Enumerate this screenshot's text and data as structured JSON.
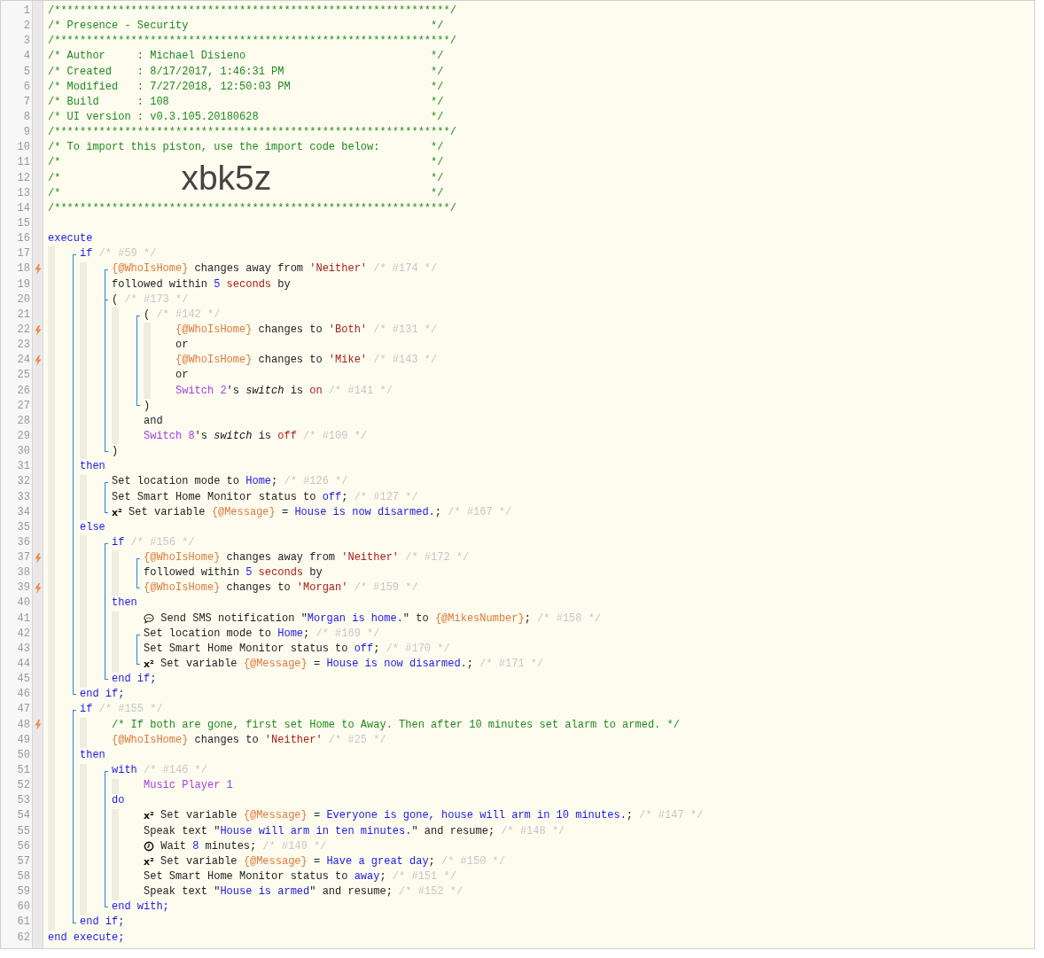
{
  "code": [
    {
      "n": "1",
      "tokens": [
        {
          "kind": "comment",
          "text": "/**************************************************************/"
        }
      ]
    },
    {
      "n": "2",
      "tokens": [
        {
          "kind": "comment",
          "text": "/* Presence - Security"
        },
        {
          "kind": "comment_end",
          "text": "*/"
        }
      ]
    },
    {
      "n": "3",
      "tokens": [
        {
          "kind": "comment",
          "text": "/**************************************************************/"
        }
      ]
    },
    {
      "n": "4",
      "tokens": [
        {
          "kind": "comment",
          "text": "/* Author     : Michael Disieno"
        },
        {
          "kind": "comment_end",
          "text": "*/"
        }
      ]
    },
    {
      "n": "5",
      "tokens": [
        {
          "kind": "comment",
          "text": "/* Created    : 8/17/2017, 1:46:31 PM"
        },
        {
          "kind": "comment_end",
          "text": "*/"
        }
      ]
    },
    {
      "n": "6",
      "tokens": [
        {
          "kind": "comment",
          "text": "/* Modified   : 7/27/2018, 12:50:03 PM"
        },
        {
          "kind": "comment_end",
          "text": "*/"
        }
      ]
    },
    {
      "n": "7",
      "tokens": [
        {
          "kind": "comment",
          "text": "/* Build      : 108"
        },
        {
          "kind": "comment_end",
          "text": "*/"
        }
      ]
    },
    {
      "n": "8",
      "tokens": [
        {
          "kind": "comment",
          "text": "/* UI version : v0.3.105.20180628"
        },
        {
          "kind": "comment_end",
          "text": "*/"
        }
      ]
    },
    {
      "n": "9",
      "tokens": [
        {
          "kind": "comment",
          "text": "/**************************************************************/"
        }
      ]
    },
    {
      "n": "10",
      "tokens": [
        {
          "kind": "comment",
          "text": "/* To import this piston, use the import code below:"
        },
        {
          "kind": "comment_end",
          "text": "*/"
        }
      ]
    },
    {
      "n": "11",
      "tokens": [
        {
          "kind": "comment",
          "text": "/*"
        },
        {
          "kind": "comment_end",
          "text": "*/"
        }
      ]
    },
    {
      "n": "12",
      "tokens": [
        {
          "kind": "comment",
          "text": "/*"
        },
        {
          "kind": "import_code",
          "text": "xbk5z"
        },
        {
          "kind": "comment_end",
          "text": "*/"
        }
      ]
    },
    {
      "n": "13",
      "tokens": [
        {
          "kind": "comment",
          "text": "/*"
        },
        {
          "kind": "comment_end",
          "text": "*/"
        }
      ]
    },
    {
      "n": "14",
      "tokens": [
        {
          "kind": "comment",
          "text": "/**************************************************************/"
        }
      ]
    },
    {
      "n": "15"
    },
    {
      "n": "16",
      "tokens": [
        {
          "kind": "keyword",
          "text": "execute"
        }
      ],
      "children": [
        {
          "kind": "group",
          "children": [
            {
              "n": "17",
              "tokens": [
                {
                  "kind": "keyword",
                  "text": "if"
                },
                {
                  "kind": "id",
                  "text": " /* #59 */"
                }
              ],
              "children": [
                {
                  "kind": "group",
                  "children": [
                    {
                      "n": "18",
                      "trigger": true,
                      "tokens": [
                        {
                          "kind": "variable",
                          "text": "{@WhoIsHome}"
                        },
                        {
                          "kind": "text",
                          "text": " changes away from "
                        },
                        {
                          "kind": "string",
                          "text": "'Neither'"
                        },
                        {
                          "kind": "id",
                          "text": " /* #174 */"
                        }
                      ]
                    },
                    {
                      "n": "19",
                      "tokens": [
                        {
                          "kind": "text",
                          "text": "followed within "
                        },
                        {
                          "kind": "number",
                          "text": "5"
                        },
                        {
                          "kind": "string",
                          "text": " seconds"
                        },
                        {
                          "kind": "text",
                          "text": " by"
                        }
                      ]
                    },
                    {
                      "kind": "group",
                      "children": [
                        {
                          "n": "20",
                          "tokens": [
                            {
                              "kind": "text",
                              "text": "("
                            },
                            {
                              "kind": "id",
                              "text": " /* #173 */"
                            }
                          ],
                          "children": [
                            {
                              "kind": "group",
                              "children": [
                                {
                                  "n": "21",
                                  "tokens": [
                                    {
                                      "kind": "text",
                                      "text": "("
                                    },
                                    {
                                      "kind": "id",
                                      "text": " /* #142 */"
                                    }
                                  ],
                                  "children": [
                                    {
                                      "n": "22",
                                      "trigger": true,
                                      "tokens": [
                                        {
                                          "kind": "variable",
                                          "text": "{@WhoIsHome}"
                                        },
                                        {
                                          "kind": "text",
                                          "text": " changes to "
                                        },
                                        {
                                          "kind": "string",
                                          "text": "'Both'"
                                        },
                                        {
                                          "kind": "id",
                                          "text": " /* #131 */"
                                        }
                                      ]
                                    },
                                    {
                                      "n": "23",
                                      "tokens": [
                                        {
                                          "kind": "text",
                                          "text": "or"
                                        }
                                      ]
                                    },
                                    {
                                      "n": "24",
                                      "trigger": true,
                                      "tokens": [
                                        {
                                          "kind": "variable",
                                          "text": "{@WhoIsHome}"
                                        },
                                        {
                                          "kind": "text",
                                          "text": " changes to "
                                        },
                                        {
                                          "kind": "string",
                                          "text": "'Mike'"
                                        },
                                        {
                                          "kind": "id",
                                          "text": " /* #143 */"
                                        }
                                      ]
                                    },
                                    {
                                      "n": "25",
                                      "tokens": [
                                        {
                                          "kind": "text",
                                          "text": "or"
                                        }
                                      ]
                                    },
                                    {
                                      "n": "26",
                                      "tokens": [
                                        {
                                          "kind": "device",
                                          "text": "Switch 2"
                                        },
                                        {
                                          "kind": "text",
                                          "text": "'s "
                                        },
                                        {
                                          "kind": "attribute",
                                          "text": "switch"
                                        },
                                        {
                                          "kind": "text",
                                          "text": " is "
                                        },
                                        {
                                          "kind": "state",
                                          "text": "on"
                                        },
                                        {
                                          "kind": "id",
                                          "text": " /* #141 */"
                                        }
                                      ]
                                    }
                                  ]
                                },
                                {
                                  "n": "27",
                                  "tokens": [
                                    {
                                      "kind": "text",
                                      "text": ")"
                                    }
                                  ]
                                }
                              ]
                            },
                            {
                              "n": "28",
                              "tokens": [
                                {
                                  "kind": "text",
                                  "text": "and"
                                }
                              ]
                            },
                            {
                              "n": "29",
                              "tokens": [
                                {
                                  "kind": "device",
                                  "text": "Switch 8"
                                },
                                {
                                  "kind": "text",
                                  "text": "'s "
                                },
                                {
                                  "kind": "attribute",
                                  "text": "switch"
                                },
                                {
                                  "kind": "text",
                                  "text": " is "
                                },
                                {
                                  "kind": "state",
                                  "text": "off"
                                },
                                {
                                  "kind": "id",
                                  "text": " /* #109 */"
                                }
                              ]
                            }
                          ]
                        },
                        {
                          "n": "30",
                          "tokens": [
                            {
                              "kind": "text",
                              "text": ")"
                            }
                          ]
                        }
                      ]
                    }
                  ]
                }
              ]
            },
            {
              "n": "31",
              "tokens": [
                {
                  "kind": "keyword",
                  "text": "then"
                }
              ],
              "children": [
                {
                  "kind": "group",
                  "children": [
                    {
                      "n": "32",
                      "tokens": [
                        {
                          "kind": "text",
                          "text": "Set location mode to "
                        },
                        {
                          "kind": "value",
                          "text": "Home"
                        },
                        {
                          "kind": "text",
                          "text": ";"
                        },
                        {
                          "kind": "id",
                          "text": " /* #126 */"
                        }
                      ]
                    },
                    {
                      "n": "33",
                      "tokens": [
                        {
                          "kind": "text",
                          "text": "Set Smart Home Monitor status to "
                        },
                        {
                          "kind": "value",
                          "text": "off"
                        },
                        {
                          "kind": "text",
                          "text": ";"
                        },
                        {
                          "kind": "id",
                          "text": " /* #127 */"
                        }
                      ]
                    },
                    {
                      "n": "34",
                      "tokens": [
                        {
                          "kind": "x2",
                          "text": "x²"
                        },
                        {
                          "kind": "text",
                          "text": " Set variable "
                        },
                        {
                          "kind": "variable",
                          "text": "{@Message}"
                        },
                        {
                          "kind": "text",
                          "text": " = "
                        },
                        {
                          "kind": "value",
                          "text": "House is now disarmed."
                        },
                        {
                          "kind": "text",
                          "text": ";"
                        },
                        {
                          "kind": "id",
                          "text": " /* #167 */"
                        }
                      ]
                    }
                  ]
                }
              ]
            },
            {
              "n": "35",
              "tokens": [
                {
                  "kind": "keyword",
                  "text": "else"
                }
              ],
              "children": [
                {
                  "kind": "group",
                  "children": [
                    {
                      "n": "36",
                      "tokens": [
                        {
                          "kind": "keyword",
                          "text": "if"
                        },
                        {
                          "kind": "id",
                          "text": " /* #156 */"
                        }
                      ],
                      "children": [
                        {
                          "kind": "group",
                          "children": [
                            {
                              "n": "37",
                              "trigger": true,
                              "tokens": [
                                {
                                  "kind": "variable",
                                  "text": "{@WhoIsHome}"
                                },
                                {
                                  "kind": "text",
                                  "text": " changes away from "
                                },
                                {
                                  "kind": "string",
                                  "text": "'Neither'"
                                },
                                {
                                  "kind": "id",
                                  "text": " /* #172 */"
                                }
                              ]
                            },
                            {
                              "n": "38",
                              "tokens": [
                                {
                                  "kind": "text",
                                  "text": "followed within "
                                },
                                {
                                  "kind": "number",
                                  "text": "5"
                                },
                                {
                                  "kind": "string",
                                  "text": " seconds"
                                },
                                {
                                  "kind": "text",
                                  "text": " by"
                                }
                              ]
                            },
                            {
                              "n": "39",
                              "trigger": true,
                              "tokens": [
                                {
                                  "kind": "variable",
                                  "text": "{@WhoIsHome}"
                                },
                                {
                                  "kind": "text",
                                  "text": " changes to "
                                },
                                {
                                  "kind": "string",
                                  "text": "'Morgan'"
                                },
                                {
                                  "kind": "id",
                                  "text": " /* #159 */"
                                }
                              ]
                            }
                          ]
                        }
                      ]
                    },
                    {
                      "n": "40",
                      "tokens": [
                        {
                          "kind": "keyword",
                          "text": "then"
                        }
                      ],
                      "children": [
                        {
                          "n": "41",
                          "tokens": [
                            {
                              "kind": "sms_icon"
                            },
                            {
                              "kind": "text",
                              "text": " Send SMS notification \""
                            },
                            {
                              "kind": "value",
                              "text": "Morgan is home."
                            },
                            {
                              "kind": "text",
                              "text": "\" to "
                            },
                            {
                              "kind": "variable",
                              "text": "{@MikesNumber}"
                            },
                            {
                              "kind": "text",
                              "text": ";"
                            },
                            {
                              "kind": "id",
                              "text": " /* #158 */"
                            }
                          ]
                        },
                        {
                          "kind": "group",
                          "children": [
                            {
                              "n": "42",
                              "tokens": [
                                {
                                  "kind": "text",
                                  "text": "Set location mode to "
                                },
                                {
                                  "kind": "value",
                                  "text": "Home"
                                },
                                {
                                  "kind": "text",
                                  "text": ";"
                                },
                                {
                                  "kind": "id",
                                  "text": " /* #169 */"
                                }
                              ]
                            },
                            {
                              "n": "43",
                              "tokens": [
                                {
                                  "kind": "text",
                                  "text": "Set Smart Home Monitor status to "
                                },
                                {
                                  "kind": "value",
                                  "text": "off"
                                },
                                {
                                  "kind": "text",
                                  "text": ";"
                                },
                                {
                                  "kind": "id",
                                  "text": " /* #170 */"
                                }
                              ]
                            },
                            {
                              "n": "44",
                              "tokens": [
                                {
                                  "kind": "x2",
                                  "text": "x²"
                                },
                                {
                                  "kind": "text",
                                  "text": " Set variable "
                                },
                                {
                                  "kind": "variable",
                                  "text": "{@Message}"
                                },
                                {
                                  "kind": "text",
                                  "text": " = "
                                },
                                {
                                  "kind": "value",
                                  "text": "House is now disarmed."
                                },
                                {
                                  "kind": "text",
                                  "text": ";"
                                },
                                {
                                  "kind": "id",
                                  "text": " /* #171 */"
                                }
                              ]
                            }
                          ]
                        }
                      ]
                    },
                    {
                      "n": "45",
                      "tokens": [
                        {
                          "kind": "keyword",
                          "text": "end if;"
                        }
                      ]
                    }
                  ]
                }
              ]
            },
            {
              "n": "46",
              "tokens": [
                {
                  "kind": "keyword",
                  "text": "end if;"
                }
              ]
            }
          ]
        },
        {
          "kind": "group",
          "children": [
            {
              "n": "47",
              "tokens": [
                {
                  "kind": "keyword",
                  "text": "if"
                },
                {
                  "kind": "id",
                  "text": " /* #155 */"
                }
              ],
              "children": [
                {
                  "n": "48",
                  "trigger": true,
                  "tokens": [
                    {
                      "kind": "comment",
                      "text": "/* If both are gone, first set Home to Away. Then after 10 minutes set alarm to armed. */"
                    }
                  ]
                },
                {
                  "n": "49",
                  "tokens": [
                    {
                      "kind": "variable",
                      "text": "{@WhoIsHome}"
                    },
                    {
                      "kind": "text",
                      "text": " changes to "
                    },
                    {
                      "kind": "string",
                      "text": "'Neither'"
                    },
                    {
                      "kind": "id",
                      "text": " /* #25 */"
                    }
                  ]
                }
              ]
            },
            {
              "n": "50",
              "tokens": [
                {
                  "kind": "keyword",
                  "text": "then"
                }
              ],
              "children": [
                {
                  "kind": "group",
                  "children": [
                    {
                      "n": "51",
                      "tokens": [
                        {
                          "kind": "keyword",
                          "text": "with"
                        },
                        {
                          "kind": "id",
                          "text": " /* #146 */"
                        }
                      ],
                      "children": [
                        {
                          "n": "52",
                          "tokens": [
                            {
                              "kind": "device",
                              "text": "Music Player 1"
                            }
                          ]
                        }
                      ]
                    },
                    {
                      "n": "53",
                      "tokens": [
                        {
                          "kind": "keyword",
                          "text": "do"
                        }
                      ],
                      "children": [
                        {
                          "n": "54",
                          "tokens": [
                            {
                              "kind": "x2",
                              "text": "x²"
                            },
                            {
                              "kind": "text",
                              "text": " Set variable "
                            },
                            {
                              "kind": "variable",
                              "text": "{@Message}"
                            },
                            {
                              "kind": "text",
                              "text": " = "
                            },
                            {
                              "kind": "value",
                              "text": "Everyone is gone, house will arm in 10 minutes."
                            },
                            {
                              "kind": "text",
                              "text": ";"
                            },
                            {
                              "kind": "id",
                              "text": " /* #147 */"
                            }
                          ]
                        },
                        {
                          "n": "55",
                          "tokens": [
                            {
                              "kind": "text",
                              "text": "Speak text \""
                            },
                            {
                              "kind": "value",
                              "text": "House will arm in ten minutes."
                            },
                            {
                              "kind": "text",
                              "text": "\" and resume;"
                            },
                            {
                              "kind": "id",
                              "text": " /* #148 */"
                            }
                          ]
                        },
                        {
                          "n": "56",
                          "tokens": [
                            {
                              "kind": "clock_icon"
                            },
                            {
                              "kind": "text",
                              "text": " Wait "
                            },
                            {
                              "kind": "number",
                              "text": "8"
                            },
                            {
                              "kind": "text",
                              "text": " minutes;"
                            },
                            {
                              "kind": "id",
                              "text": " /* #149 */"
                            }
                          ]
                        },
                        {
                          "n": "57",
                          "tokens": [
                            {
                              "kind": "x2",
                              "text": "x²"
                            },
                            {
                              "kind": "text",
                              "text": " Set variable "
                            },
                            {
                              "kind": "variable",
                              "text": "{@Message}"
                            },
                            {
                              "kind": "text",
                              "text": " = "
                            },
                            {
                              "kind": "value",
                              "text": "Have a great day"
                            },
                            {
                              "kind": "text",
                              "text": ";"
                            },
                            {
                              "kind": "id",
                              "text": " /* #150 */"
                            }
                          ]
                        },
                        {
                          "n": "58",
                          "tokens": [
                            {
                              "kind": "text",
                              "text": "Set Smart Home Monitor status to "
                            },
                            {
                              "kind": "value",
                              "text": "away"
                            },
                            {
                              "kind": "text",
                              "text": ";"
                            },
                            {
                              "kind": "id",
                              "text": " /* #151 */"
                            }
                          ]
                        },
                        {
                          "n": "59",
                          "tokens": [
                            {
                              "kind": "text",
                              "text": "Speak text \""
                            },
                            {
                              "kind": "value",
                              "text": "House is armed"
                            },
                            {
                              "kind": "text",
                              "text": "\" and resume;"
                            },
                            {
                              "kind": "id",
                              "text": " /* #152 */"
                            }
                          ]
                        }
                      ]
                    },
                    {
                      "n": "60",
                      "tokens": [
                        {
                          "kind": "keyword",
                          "text": "end with;"
                        }
                      ]
                    }
                  ]
                }
              ]
            },
            {
              "n": "61",
              "tokens": [
                {
                  "kind": "keyword",
                  "text": "end if;"
                }
              ]
            }
          ]
        }
      ]
    },
    {
      "n": "62",
      "tokens": [
        {
          "kind": "keyword",
          "text": "end execute;"
        }
      ]
    }
  ]
}
